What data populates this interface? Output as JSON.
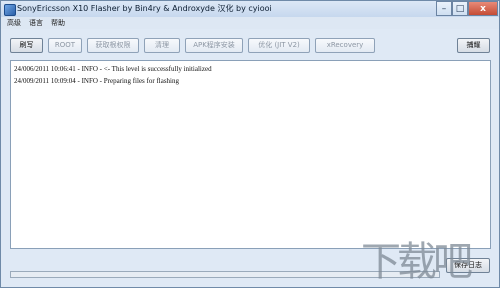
{
  "window": {
    "title": "SonyEricsson X10 Flasher by Bin4ry & Androxyde 汉化 by cyiooi",
    "controls": {
      "minimize": "–",
      "maximize": "□",
      "close": "x"
    }
  },
  "menu": [
    "高级",
    "语言",
    "帮助"
  ],
  "toolbar": {
    "flash": "刷写",
    "root": "ROOT",
    "get_root": "获取根权限",
    "clean": "清理",
    "apk_install": "APK程序安装",
    "optimize": "优化 (JIT V2)",
    "xrecovery": "xRecovery",
    "dump": "捕耀"
  },
  "log": [
    "24/006/2011 10:06:41 - INFO  - <- This level is successfully initialized",
    "24/009/2011 10:09:04 - INFO  - Preparing files for flashing"
  ],
  "progress": {
    "value": 0
  },
  "save_log": "保存日志",
  "watermark": "下载吧"
}
